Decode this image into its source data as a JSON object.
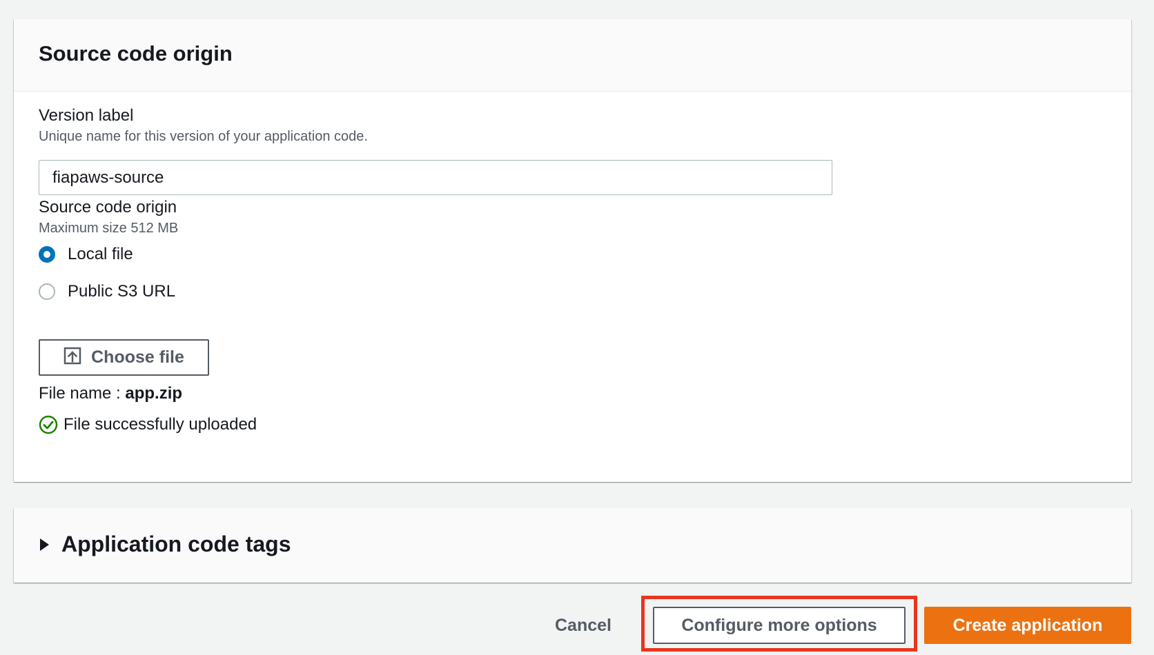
{
  "source_section": {
    "title": "Source code origin",
    "version_label": {
      "label": "Version label",
      "description": "Unique name for this version of your application code.",
      "value": "fiapaws-source"
    },
    "origin": {
      "label": "Source code origin",
      "description": "Maximum size 512 MB",
      "options": [
        {
          "label": "Local file",
          "selected": true
        },
        {
          "label": "Public S3 URL",
          "selected": false
        }
      ]
    },
    "choose_file_label": "Choose file",
    "file_name_label": "File name :",
    "file_name_value": "app.zip",
    "upload_status": "File successfully uploaded"
  },
  "tags_section": {
    "title": "Application code tags",
    "expanded": false
  },
  "footer": {
    "cancel_label": "Cancel",
    "configure_label": "Configure more options",
    "create_label": "Create application"
  },
  "colors": {
    "primary": "#ec7211",
    "radio_selected": "#0073bb",
    "success": "#1d8102",
    "highlight": "#e8361e"
  },
  "icons": {
    "upload": "upload-icon",
    "success": "status-success-icon",
    "caret": "caret-right-icon"
  }
}
